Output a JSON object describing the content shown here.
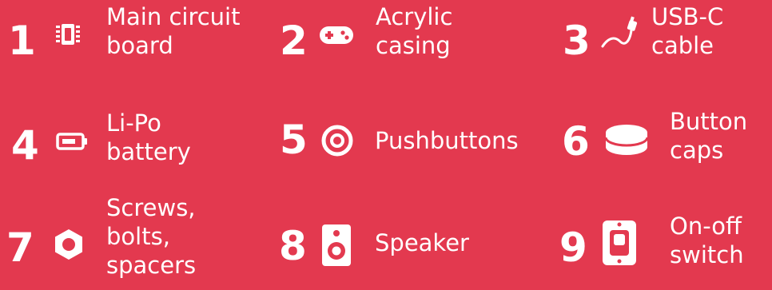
{
  "background_color": "#e3394f",
  "foreground_color": "#ffffff",
  "items": [
    {
      "number": "1",
      "icon": "circuit-chip-icon",
      "lines": [
        "Main circuit",
        "board"
      ]
    },
    {
      "number": "2",
      "icon": "gamepad-icon",
      "lines": [
        "Acrylic",
        "casing"
      ]
    },
    {
      "number": "3",
      "icon": "usb-cable-icon",
      "lines": [
        "USB-C",
        "cable"
      ]
    },
    {
      "number": "4",
      "icon": "battery-icon",
      "lines": [
        "Li-Po",
        "battery"
      ]
    },
    {
      "number": "5",
      "icon": "target-button-icon",
      "lines": [
        "Pushbuttons"
      ]
    },
    {
      "number": "6",
      "icon": "button-cap-icon",
      "lines": [
        "Button",
        "caps"
      ]
    },
    {
      "number": "7",
      "icon": "hex-nut-icon",
      "lines": [
        "Screws,",
        "bolts,",
        "spacers"
      ]
    },
    {
      "number": "8",
      "icon": "speaker-icon",
      "lines": [
        "Speaker"
      ]
    },
    {
      "number": "9",
      "icon": "toggle-switch-icon",
      "lines": [
        "On-off",
        "switch"
      ]
    }
  ]
}
